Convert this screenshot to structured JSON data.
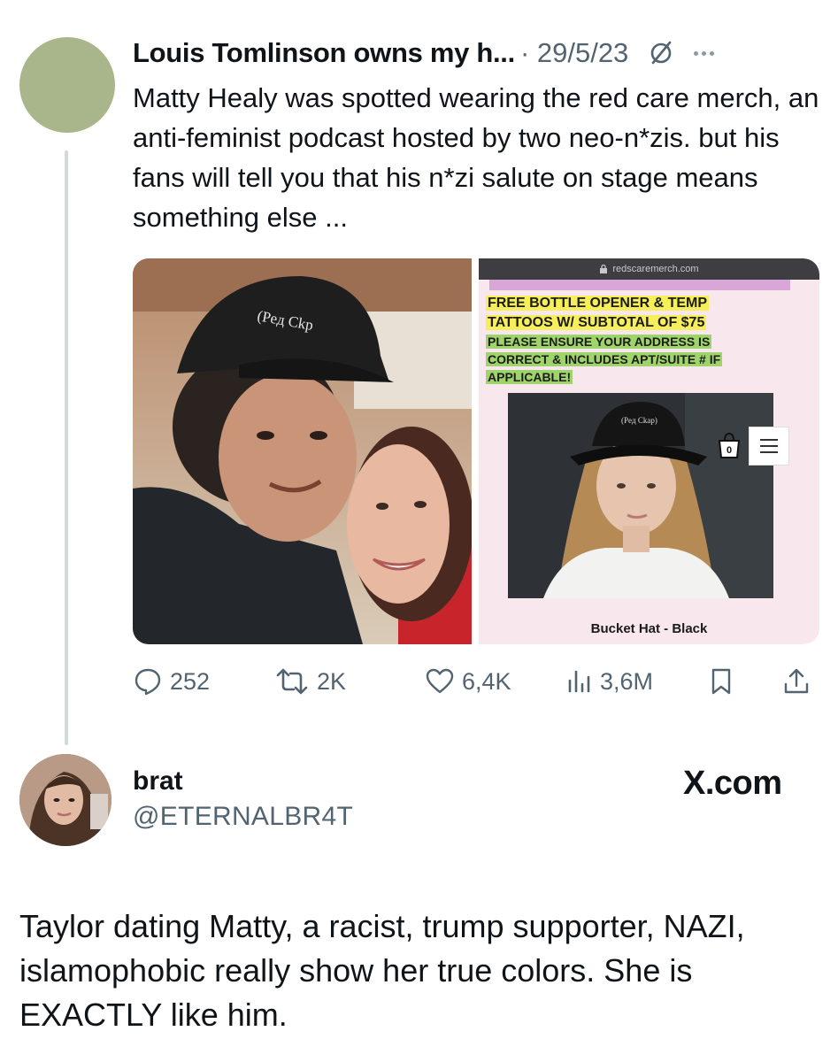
{
  "parent_tweet": {
    "author": "Louis Tomlinson owns my h...",
    "date": "· 29/5/23",
    "text": "Matty Healy was spotted wearing the red care merch, an anti-feminist podcast hosted by two neo-n*zis. but his fans will tell you that his n*zi salute on stage means something else ...",
    "media": {
      "site_url": "redscaremerch.com",
      "promo_line_1": "FREE BOTTLE OPENER & TEMP",
      "promo_line_2": "TATTOOS W/ SUBTOTAL OF $75",
      "promo_line_3": "PLEASE ENSURE YOUR ADDRESS IS",
      "promo_line_4": "CORRECT & INCLUDES APT/SUITE # IF",
      "promo_line_5": "APPLICABLE!",
      "cart_count": "0",
      "product_label": "Bucket Hat - Black",
      "cap_text": "(Peд Ckp",
      "bucket_hat_text": "(Peд Ckap)"
    },
    "stats": {
      "replies": "252",
      "reposts": "2K",
      "likes": "6,4K",
      "views": "3,6M"
    }
  },
  "user": {
    "name": "brat",
    "handle": "@ETERNALBR4T"
  },
  "watermark": "X.com",
  "body_text": "Taylor dating Matty, a racist, trump supporter, NAZI, islamophobic really show her true colors. She is EXACTLY like him.",
  "colors": {
    "avatar_placeholder": "#a9b58a",
    "secondary_text": "#536471",
    "promo_yellow": "#f6ef5a",
    "promo_green": "#9fd46a",
    "shop_background": "#f9e7ee"
  }
}
